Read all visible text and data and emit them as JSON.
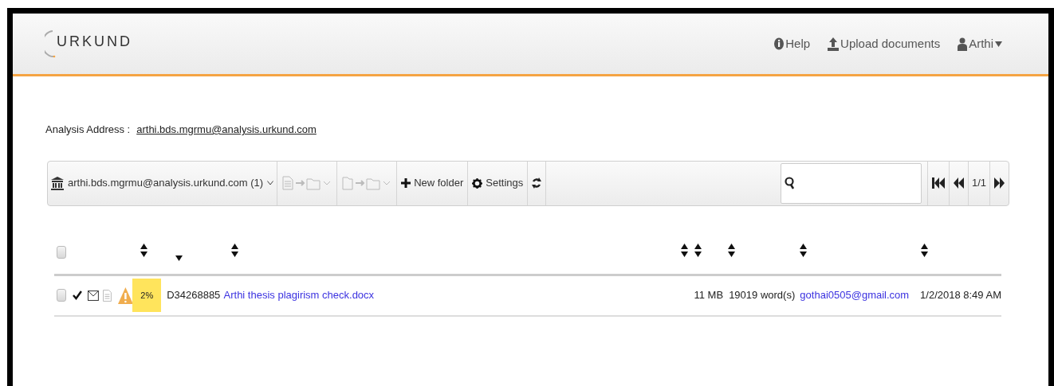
{
  "header": {
    "logo": "URKUND",
    "nav": [
      {
        "kind": "help",
        "label": "Help"
      },
      {
        "kind": "upload",
        "label": "Upload documents"
      },
      {
        "kind": "user",
        "label": "Arthi"
      }
    ]
  },
  "analysis_address": {
    "label": "Analysis Address :",
    "value": "arthi.bds.mgrmu@analysis.urkund.com"
  },
  "toolbar": {
    "inbox": "arthi.bds.mgrmu@analysis.urkund.com (1)",
    "new_folder": "New folder",
    "settings": "Settings",
    "page": "1/1"
  },
  "table": {
    "header_checkbox": {
      "checked": false
    },
    "sort_columns": [
      {
        "active": false
      },
      {
        "active": true
      },
      {
        "active": false
      },
      {
        "active": false
      },
      {
        "active": false
      },
      {
        "active": false
      },
      {
        "active": false
      },
      {
        "active": false
      }
    ],
    "rows": [
      {
        "checked": false,
        "score": "2%",
        "color": "#ffe45c",
        "id": "D34268885",
        "name": "Arthi thesis plagirism check.docx",
        "size": "11 MB",
        "words": "19019 word(s)",
        "email": "gothai0505@gmail.com",
        "date": "1/2/2018 8:49 AM"
      }
    ]
  }
}
